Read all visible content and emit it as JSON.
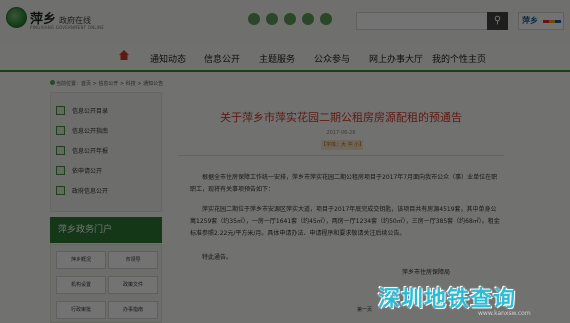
{
  "header": {
    "logo_title": "萍乡",
    "logo_title_suffix": "政府在线",
    "logo_subtitle": "PINGXIANG GOVERNMENT ONLINE",
    "search_placeholder": "",
    "search_icon": "search-icon",
    "brand_badge": "萍乡"
  },
  "nav": {
    "home_icon": "home-icon",
    "items": [
      {
        "label": "通知动态"
      },
      {
        "label": "信息公开"
      },
      {
        "label": "主题服务"
      },
      {
        "label": "公众参与"
      },
      {
        "label": "网上办事大厅"
      },
      {
        "label": "我的个性主页"
      }
    ]
  },
  "breadcrumb": "当前位置：首页 > 信息公开 > 科技 > 通知公告",
  "sidebar": {
    "items": [
      {
        "label": "信息公开目录"
      },
      {
        "label": "信息公开指南"
      },
      {
        "label": "信息公开年报"
      },
      {
        "label": "依申请公开"
      },
      {
        "label": "政府信息公开"
      }
    ],
    "section_title": "萍乡政务门户",
    "grid": [
      {
        "label": "萍乡概况"
      },
      {
        "label": "市领导"
      },
      {
        "label": "机构设置"
      },
      {
        "label": "政策文件"
      },
      {
        "label": "行政审批"
      },
      {
        "label": "办事指南"
      }
    ]
  },
  "article": {
    "title": "关于萍乡市萍实花园二期公租房房源配租的预通告",
    "date": "2017-06-26",
    "badge": "【字体：大 中 小】",
    "paragraphs": [
      "根据全市住房保障工作统一安排，萍乡市萍实花园二期公租房项目于2017年7月面向我市公众（事）业单位在职职工，现将有关事项预告如下：",
      "萍实花园二期位于萍乡市安源区萍实大道，项目于2017年底完成交钥匙，该项目共有房源4519套，其中单身公寓1259套（约35㎡），一房一厅1641套（约45㎡），两房一厅1234套（约50㎡），三房一厅385套（约68㎡）。租金标准参照2.22元/平方米/月。具体申请办法、申请程序和要求敬请关注后续公告。",
      "特此通告。"
    ],
    "signature": "萍乡市住房保障局",
    "pager_label": "第一页"
  },
  "watermark": {
    "text": "深圳地铁查询",
    "url": "www.kanxsw.com"
  }
}
